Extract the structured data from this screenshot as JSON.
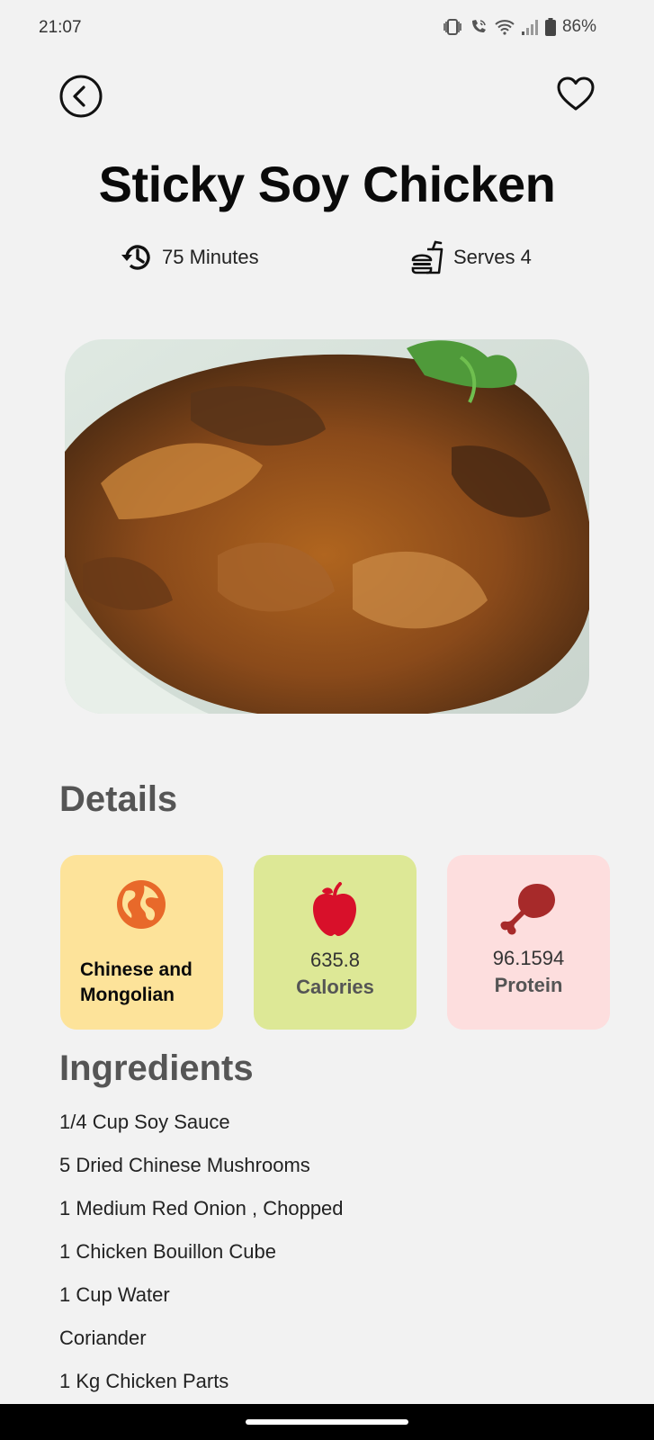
{
  "status_bar": {
    "time": "21:07",
    "battery": "86%",
    "icons": [
      "vibrate-icon",
      "wifi-calling-icon",
      "wifi-icon",
      "signal-icon",
      "battery-icon"
    ]
  },
  "header": {
    "back_icon": "back-arrow-icon",
    "favorite_icon": "heart-icon"
  },
  "recipe": {
    "title": "Sticky Soy Chicken",
    "time": "75 Minutes",
    "serves": "Serves 4",
    "time_icon": "history-clock-icon",
    "serves_icon": "fast-food-icon"
  },
  "details": {
    "heading": "Details",
    "cuisine": {
      "label": "Chinese and Mongolian",
      "icon": "globe-icon",
      "color": "#e8692a",
      "bg": "#fde39a"
    },
    "calories": {
      "value": "635.8",
      "label": "Calories",
      "icon": "apple-icon",
      "color": "#d8102a",
      "bg": "#dde896"
    },
    "protein": {
      "value": "96.1594",
      "label": "Protein",
      "icon": "drumstick-icon",
      "color": "#a72a2a",
      "bg": "#fddede"
    }
  },
  "ingredients": {
    "heading": "Ingredients",
    "items": [
      "1/4 Cup Soy Sauce",
      "5 Dried Chinese Mushrooms",
      "1 Medium Red Onion , Chopped",
      "1 Chicken Bouillon Cube",
      "1 Cup Water",
      "Coriander",
      "1 Kg Chicken Parts"
    ]
  }
}
